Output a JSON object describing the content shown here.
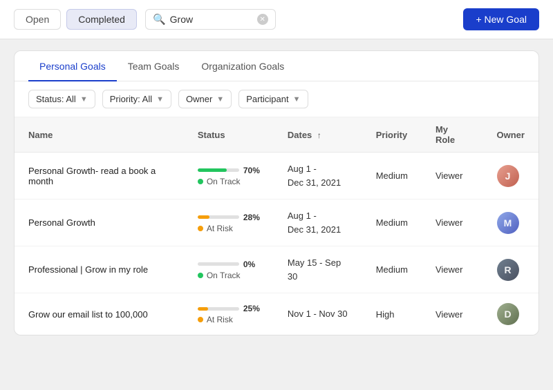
{
  "topbar": {
    "open_label": "Open",
    "completed_label": "Completed",
    "search_value": "Grow",
    "new_goal_label": "+ New Goal"
  },
  "goal_tabs": [
    {
      "id": "personal",
      "label": "Personal Goals",
      "active": true
    },
    {
      "id": "team",
      "label": "Team Goals",
      "active": false
    },
    {
      "id": "org",
      "label": "Organization Goals",
      "active": false
    }
  ],
  "filters": [
    {
      "id": "status",
      "label": "Status: All"
    },
    {
      "id": "priority",
      "label": "Priority: All"
    },
    {
      "id": "owner",
      "label": "Owner"
    },
    {
      "id": "participant",
      "label": "Participant"
    }
  ],
  "columns": [
    {
      "id": "name",
      "label": "Name"
    },
    {
      "id": "status",
      "label": "Status"
    },
    {
      "id": "dates",
      "label": "Dates",
      "sort": "asc"
    },
    {
      "id": "priority",
      "label": "Priority"
    },
    {
      "id": "my_role",
      "label": "My Role"
    },
    {
      "id": "owner",
      "label": "Owner"
    }
  ],
  "goals": [
    {
      "name": "Personal Growth- read a book a month",
      "progress": 70,
      "status_label": "On Track",
      "status_type": "green",
      "dates_line1": "Aug 1 -",
      "dates_line2": "Dec 31, 2021",
      "priority": "Medium",
      "my_role": "Viewer",
      "avatar_class": "av1",
      "avatar_initials": "J"
    },
    {
      "name": "Personal Growth",
      "progress": 28,
      "status_label": "At Risk",
      "status_type": "orange",
      "dates_line1": "Aug 1 -",
      "dates_line2": "Dec 31, 2021",
      "priority": "Medium",
      "my_role": "Viewer",
      "avatar_class": "av2",
      "avatar_initials": "M"
    },
    {
      "name": "Professional | Grow in my role",
      "progress": 0,
      "status_label": "On Track",
      "status_type": "green",
      "dates_line1": "May 15 - Sep 30",
      "dates_line2": "",
      "priority": "Medium",
      "my_role": "Viewer",
      "avatar_class": "av3",
      "avatar_initials": "R"
    },
    {
      "name": "Grow our email list to 100,000",
      "progress": 25,
      "status_label": "At Risk",
      "status_type": "orange",
      "dates_line1": "Nov 1 - Nov 30",
      "dates_line2": "",
      "priority": "High",
      "my_role": "Viewer",
      "avatar_class": "av4",
      "avatar_initials": "D"
    }
  ],
  "colors": {
    "accent": "#1a3ecb",
    "green": "#22c55e",
    "orange": "#f59e0b",
    "progress_green": "#22c55e",
    "progress_orange": "#f59e0b",
    "progress_gray": "#e0e0e0"
  }
}
